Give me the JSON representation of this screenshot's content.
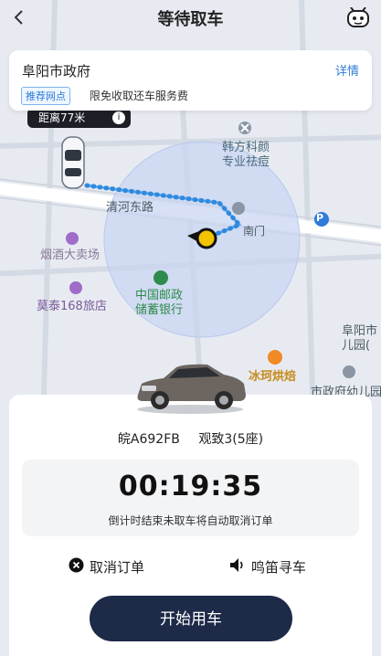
{
  "header": {
    "title": "等待取车"
  },
  "location_card": {
    "name": "阜阳市政府",
    "detail_link": "详情",
    "badge": "推荐网点",
    "note": "限免收取还车服务费"
  },
  "map": {
    "distance_tag": "距离77米",
    "labels": {
      "road": "清河东路",
      "cosmetic": "韩方科颜",
      "cosmetic_sub": "专业祛痘",
      "tobacco": "烟酒大卖场",
      "hotel": "莫泰168旅店",
      "bank1": "中国邮政",
      "bank2": "储蓄银行",
      "bakery": "冰珂烘焙",
      "kindergarten1": "阜阳市",
      "kindergarten2": "儿园(",
      "kindergarten_full": "市政府幼儿园",
      "gate": "南门",
      "parking": "P"
    }
  },
  "vehicle": {
    "plate": "皖A692FB",
    "model": "观致3(5座)"
  },
  "timer": {
    "value": "00:19:35",
    "note": "倒计时结束未取车将自动取消订单"
  },
  "actions": {
    "cancel": "取消订单",
    "honk": "鸣笛寻车",
    "start": "开始用车"
  },
  "colors": {
    "route": "#2f8ae0",
    "button": "#1d2a48",
    "accent": "#2f7bd9",
    "marker": "#f2c300"
  }
}
